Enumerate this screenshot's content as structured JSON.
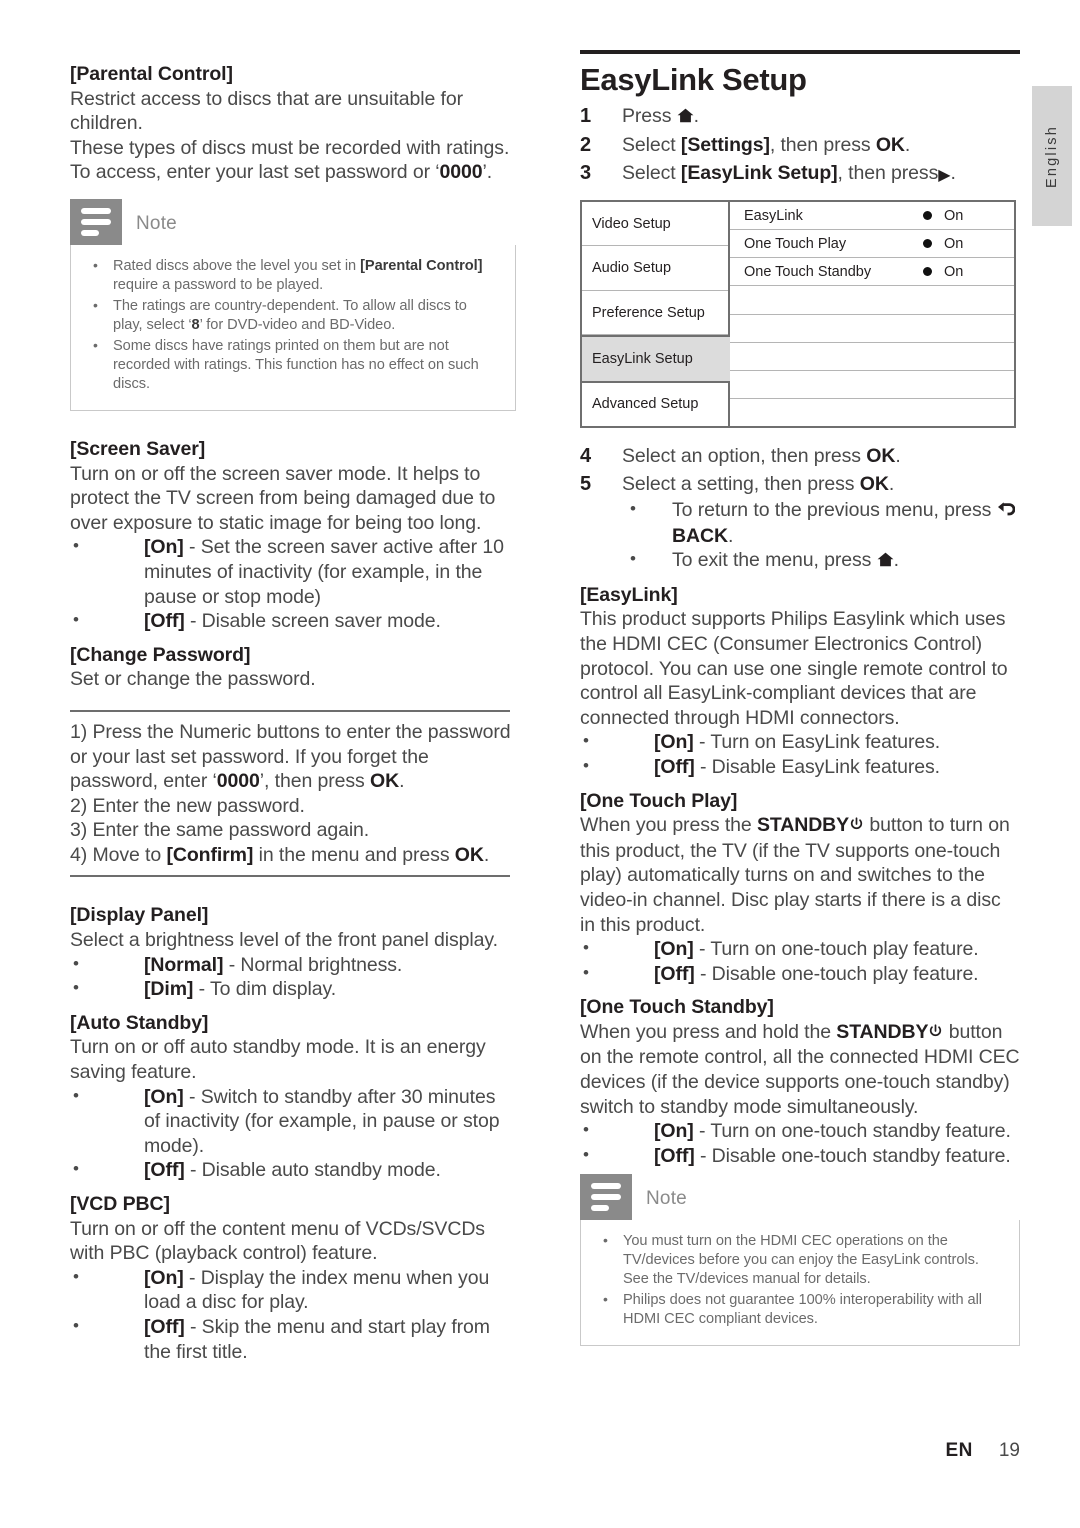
{
  "page": {
    "language_tab": "English",
    "footer_locale": "EN",
    "footer_page": "19"
  },
  "left_column": {
    "parental_control": {
      "heading": "[Parental Control]",
      "body_line1": "Restrict access to discs that are unsuitable for children.",
      "body_line2": "These types of discs must be recorded with ratings.",
      "body_line3_a": "To access, enter your last set password or ‘",
      "body_line3_b": "0000",
      "body_line3_c": "’."
    },
    "note1": {
      "title": "Note",
      "items": [
        {
          "a": "Rated discs above the level you set in ",
          "b": "[Parental Control]",
          "c": " require a password to be played."
        },
        {
          "a": "The ratings are country-dependent. To allow all discs to play, select ‘",
          "b": "8",
          "c": "’ for DVD-video and BD-Video."
        },
        {
          "a": "Some discs have ratings printed on them but are not recorded with ratings. This function has no effect on such discs.",
          "b": "",
          "c": ""
        }
      ]
    },
    "screen_saver": {
      "heading": "[Screen Saver]",
      "body": "Turn on or off the screen saver mode. It helps to protect the TV screen from being damaged due to over exposure to static image for being too long.",
      "options": [
        {
          "label": "[On]",
          "text": " - Set the screen saver active after 10 minutes of inactivity (for example, in the pause or stop mode)"
        },
        {
          "label": "[Off]",
          "text": " - Disable screen saver mode."
        }
      ]
    },
    "change_password": {
      "heading": "[Change Password]",
      "body": "Set or change the password.",
      "steps": [
        {
          "a": "1) Press the Numeric buttons to enter the password or your last set password. If you forget the password, enter ‘",
          "b": "0000",
          "c": "’, then press ",
          "d": "OK",
          "e": "."
        },
        {
          "a": "2) Enter the new password.",
          "b": "",
          "c": "",
          "d": "",
          "e": ""
        },
        {
          "a": "3) Enter the same password again.",
          "b": "",
          "c": "",
          "d": "",
          "e": ""
        },
        {
          "a": "4) Move to ",
          "b": "[Confirm]",
          "c": " in the menu and press ",
          "d": "OK",
          "e": "."
        }
      ]
    },
    "display_panel": {
      "heading": "[Display Panel]",
      "body": "Select a brightness level of the front panel display.",
      "options": [
        {
          "label": "[Normal]",
          "text": " - Normal brightness."
        },
        {
          "label": "[Dim]",
          "text": " - To dim display."
        }
      ]
    },
    "auto_standby": {
      "heading": "[Auto Standby]",
      "body": "Turn on or off auto standby mode. It is an energy saving feature.",
      "options": [
        {
          "label": "[On]",
          "text": " - Switch to standby after 30 minutes of inactivity (for example, in pause or stop mode)."
        },
        {
          "label": "[Off]",
          "text": " - Disable auto standby mode."
        }
      ]
    },
    "vcd_pbc": {
      "heading": "[VCD PBC]",
      "body": "Turn on or off the content menu of VCDs/SVCDs with PBC (playback control) feature.",
      "options": [
        {
          "label": "[On]",
          "text": " - Display the index menu when you load a disc for play."
        },
        {
          "label": "[Off]",
          "text": " - Skip the menu and start play from the first title."
        }
      ]
    }
  },
  "right_column": {
    "chapter_title": "EasyLink Setup",
    "steps_top": [
      {
        "num": "1",
        "a": "Press ",
        "icon": "home",
        "b": "",
        "c": "",
        "d": "."
      },
      {
        "num": "2",
        "a": "Select ",
        "icon": "",
        "b": "[Settings]",
        "c": ", then press ",
        "d": "OK",
        "e": "."
      },
      {
        "num": "3",
        "a": "Select ",
        "icon": "",
        "b": "[EasyLink Setup]",
        "c": ", then press",
        "d": "▶",
        "e": "."
      }
    ],
    "osd_menu": {
      "left_items": [
        {
          "label": "Video Setup",
          "selected": false
        },
        {
          "label": "Audio Setup",
          "selected": false
        },
        {
          "label": "Preference Setup",
          "selected": false
        },
        {
          "label": "EasyLink Setup",
          "selected": true
        },
        {
          "label": "Advanced Setup",
          "selected": false
        }
      ],
      "right_rows": [
        {
          "label": "EasyLink",
          "value": "On",
          "has_dot": true
        },
        {
          "label": "One Touch Play",
          "value": "On",
          "has_dot": true
        },
        {
          "label": "One Touch Standby",
          "value": "On",
          "has_dot": true
        },
        {
          "label": "",
          "value": "",
          "has_dot": false
        },
        {
          "label": "",
          "value": "",
          "has_dot": false
        },
        {
          "label": "",
          "value": "",
          "has_dot": false
        },
        {
          "label": "",
          "value": "",
          "has_dot": false
        },
        {
          "label": "",
          "value": "",
          "has_dot": false
        }
      ]
    },
    "steps_bottom": {
      "step4": {
        "num": "4",
        "a": "Select an option, then press ",
        "b": "OK",
        "c": "."
      },
      "step5": {
        "num": "5",
        "a": "Select a setting, then press ",
        "b": "OK",
        "c": "."
      },
      "sub1_a": "To return to the previous menu, press ",
      "sub1_b": "BACK",
      "sub1_c": ".",
      "sub2_a": "To exit the menu, press ",
      "sub2_c": "."
    },
    "easylink": {
      "heading": "[EasyLink]",
      "body": "This product supports Philips Easylink which uses the HDMI CEC (Consumer Electronics Control) protocol. You can use one single remote control to control all EasyLink-compliant devices that are connected through HDMI connectors.",
      "options": [
        {
          "label": "[On]",
          "text": " - Turn on EasyLink features."
        },
        {
          "label": "[Off]",
          "text": " - Disable EasyLink features."
        }
      ]
    },
    "one_touch_play": {
      "heading": "[One Touch Play]",
      "body_a": "When you press the ",
      "body_b": "STANDBY",
      "body_c": " button to turn on this product, the TV (if the TV supports one-touch play) automatically turns on and switches to the video-in channel. Disc play starts if there is a disc in this product.",
      "options": [
        {
          "label": "[On]",
          "text": " - Turn on one-touch play feature."
        },
        {
          "label": "[Off]",
          "text": " - Disable one-touch play feature."
        }
      ]
    },
    "one_touch_standby": {
      "heading": "[One Touch Standby]",
      "body_a": "When you press and hold the ",
      "body_b": "STANDBY",
      "body_c": " button on the remote control, all the connected HDMI CEC devices (if the device supports one-touch standby) switch to standby mode simultaneously.",
      "options": [
        {
          "label": "[On]",
          "text": " - Turn on one-touch standby feature."
        },
        {
          "label": "[Off]",
          "text": " - Disable one-touch standby feature."
        }
      ]
    },
    "note2": {
      "title": "Note",
      "items": [
        {
          "a": "You must turn on the HDMI CEC operations on the TV/devices before you can enjoy the EasyLink controls. See the TV/devices manual for details."
        },
        {
          "a": "Philips does not guarantee 100% interoperability with all HDMI CEC compliant devices."
        }
      ]
    }
  }
}
